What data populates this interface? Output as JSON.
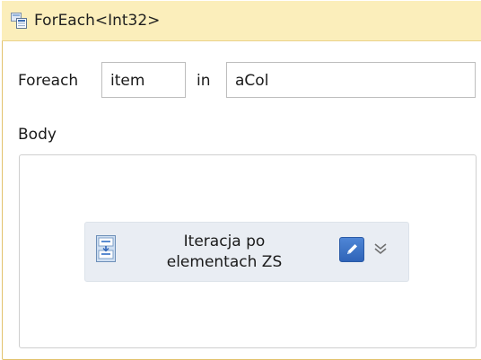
{
  "activity": {
    "title": "ForEach<Int32>",
    "icon": "foreach-activity-icon",
    "foreach_label": "Foreach",
    "item_value": "item",
    "in_label": "in",
    "collection_value": "aCol",
    "body_label": "Body"
  },
  "body": {
    "inner_activity": {
      "label": "Iteracja po elementach ZS",
      "icon": "sequence-activity-icon",
      "edit_icon": "pencil-icon",
      "expand_icon": "double-chevron-down-icon"
    }
  },
  "colors": {
    "header_bg": "#fbeebb",
    "frame_border": "#e2c26c",
    "inner_bg": "#e9edf3",
    "edit_button": "#3a70c4"
  }
}
